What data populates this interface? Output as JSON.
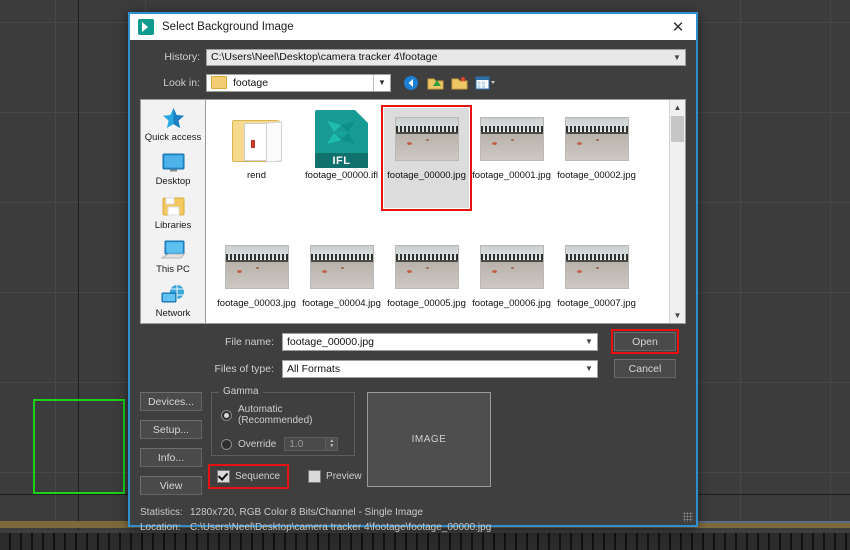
{
  "dialog": {
    "title": "Select Background Image",
    "close_label": "✕",
    "history": {
      "label": "History:",
      "value": "C:\\Users\\Neel\\Desktop\\camera tracker 4\\footage"
    },
    "look_in": {
      "label": "Look in:",
      "value": "footage"
    },
    "nav_icons": [
      {
        "name": "back-icon",
        "title": "Back"
      },
      {
        "name": "up-folder-icon",
        "title": "Up One Level"
      },
      {
        "name": "new-folder-icon",
        "title": "Create New Folder"
      },
      {
        "name": "views-icon",
        "title": "Views"
      }
    ],
    "places": [
      {
        "label": "Quick access",
        "icon": "star-icon"
      },
      {
        "label": "Desktop",
        "icon": "desktop-icon"
      },
      {
        "label": "Libraries",
        "icon": "libraries-icon"
      },
      {
        "label": "This PC",
        "icon": "computer-icon"
      },
      {
        "label": "Network",
        "icon": "network-icon"
      }
    ],
    "files": [
      {
        "name": "rend",
        "type": "folder",
        "selected": false
      },
      {
        "name": "footage_00000.ifl",
        "type": "ifl",
        "selected": false
      },
      {
        "name": "footage_00000.jpg",
        "type": "image",
        "selected": true
      },
      {
        "name": "footage_00001.jpg",
        "type": "image",
        "selected": false
      },
      {
        "name": "footage_00002.jpg",
        "type": "image",
        "selected": false
      },
      {
        "name": "footage_00003.jpg",
        "type": "image",
        "selected": false
      },
      {
        "name": "footage_00004.jpg",
        "type": "image",
        "selected": false
      },
      {
        "name": "footage_00005.jpg",
        "type": "image",
        "selected": false
      },
      {
        "name": "footage_00006.jpg",
        "type": "image",
        "selected": false
      },
      {
        "name": "footage_00007.jpg",
        "type": "image",
        "selected": false
      }
    ],
    "ifl_badge": "IFL",
    "file_name": {
      "label": "File name:",
      "value": "footage_00000.jpg"
    },
    "files_of_type": {
      "label": "Files of type:",
      "value": "All Formats"
    },
    "open_button": "Open",
    "cancel_button": "Cancel",
    "side_buttons": [
      "Devices...",
      "Setup...",
      "Info...",
      "View"
    ],
    "gamma": {
      "title": "Gamma",
      "automatic_label": "Automatic (Recommended)",
      "automatic_selected": true,
      "override_label": "Override",
      "override_selected": false,
      "override_value": "1.0"
    },
    "sequence": {
      "label": "Sequence",
      "checked": true
    },
    "preview": {
      "label": "Preview",
      "checked": false
    },
    "image_preview_label": "IMAGE",
    "statistics": {
      "label": "Statistics:",
      "value": "1280x720, RGB Color 8 Bits/Channel - Single Image"
    },
    "location": {
      "label": "Location:",
      "value": "C:\\Users\\Neel\\Desktop\\camera tracker 4\\footage\\footage_00000.jpg"
    }
  },
  "colors": {
    "accent_border": "#2e8fd0",
    "highlight_red": "#e81010",
    "selection_green": "#19d219",
    "dialog_bg": "#3f3f3f",
    "viewport_bg": "#3c3c3c"
  }
}
